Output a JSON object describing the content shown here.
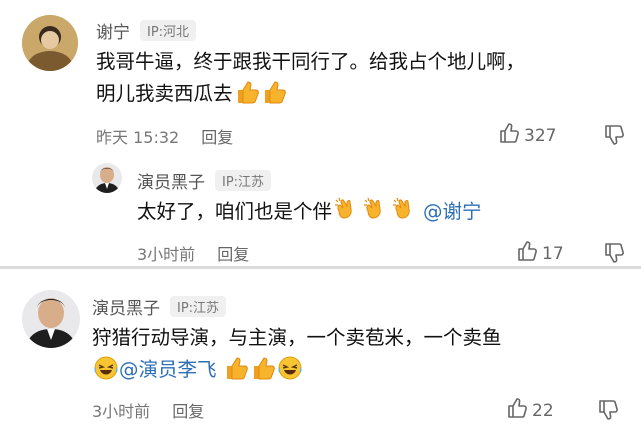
{
  "comments": [
    {
      "author": "谢宁",
      "ip": "IP:河北",
      "text_line1": "我哥牛逼，终于跟我干同行了。给我占个地儿啊，",
      "text_line2": "明儿我卖西瓜去",
      "emojis": [
        "thumbs-up",
        "thumbs-up"
      ],
      "time": "昨天 15:32",
      "reply_label": "回复",
      "likes": "327",
      "reply": {
        "author": "演员黑子",
        "ip": "IP:江苏",
        "text": "太好了，咱们也是个伴",
        "emojis": [
          "clapping-hands",
          "clapping-hands",
          "clapping-hands"
        ],
        "mention": "@谢宁",
        "time": "3小时前",
        "reply_label": "回复",
        "likes": "17"
      }
    },
    {
      "author": "演员黑子",
      "ip": "IP:江苏",
      "text_line1": "狩猎行动导演，与主演，一个卖苞米，一个卖鱼",
      "emojis_before_mention": [
        "laughing-face"
      ],
      "mention": "@演员李飞",
      "emojis_after_mention": [
        "thumbs-up",
        "thumbs-up",
        "laughing-face"
      ],
      "time": "3小时前",
      "reply_label": "回复",
      "likes": "22"
    }
  ],
  "colors": {
    "mention": "#2d6fb6",
    "meta": "#777777",
    "divider": "#dcdcdc"
  }
}
